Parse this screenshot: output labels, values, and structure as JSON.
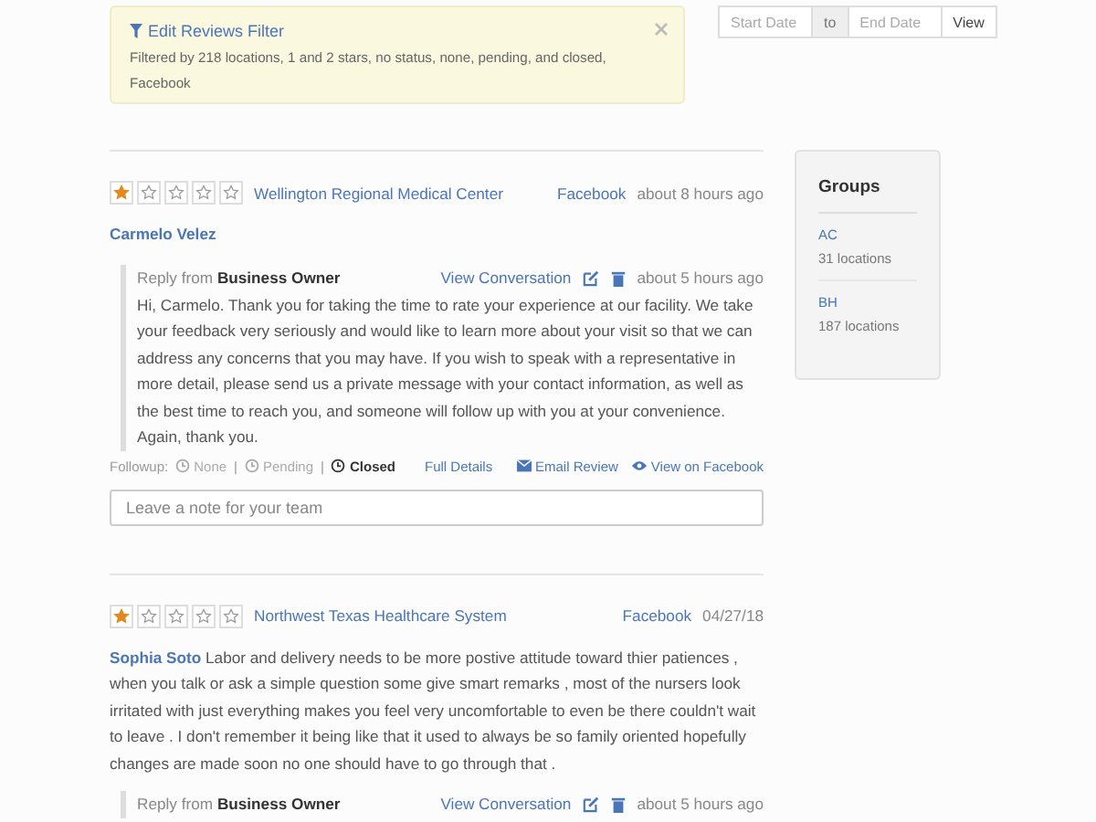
{
  "filter": {
    "title": "Edit Reviews Filter",
    "description": "Filtered by 218 locations, 1 and 2 stars, no status, none, pending, and closed, Facebook"
  },
  "date_range": {
    "start_placeholder": "Start Date",
    "separator": "to",
    "end_placeholder": "End Date",
    "button": "View"
  },
  "reviews": [
    {
      "stars": 1,
      "location": "Wellington Regional Medical Center",
      "source": "Facebook",
      "time": "about 8 hours ago",
      "author": "Carmelo Velez",
      "reply": {
        "prefix": "Reply from",
        "author": "Business Owner",
        "link": "View Conversation",
        "time": "about 5 hours ago",
        "text": "Hi, Carmelo. Thank you for taking the time to rate your experience at our facility. We take your feedback very seriously and would like to learn more about your visit so that we can address any concerns that you may have. If you wish to speak with a representative in more detail, please send us a private message with your contact information, as well as the best time to reach you, and someone will follow up with you at your convenience. Again, thank you."
      },
      "followup": {
        "label": "Followup:",
        "separator": "|",
        "options": [
          {
            "label": "None",
            "selected": false
          },
          {
            "label": "Pending",
            "selected": false
          },
          {
            "label": "Closed",
            "selected": true
          }
        ]
      },
      "details_link": "Full Details",
      "actions": [
        {
          "kind": "email",
          "label": "Email Review"
        },
        {
          "kind": "view",
          "label": "View on Facebook"
        }
      ],
      "note_placeholder": "Leave a note for your team"
    },
    {
      "stars": 1,
      "location": "Northwest Texas Healthcare System",
      "source": "Facebook",
      "time": "04/27/18",
      "author": "Sophia Soto",
      "text": "Labor and delivery needs to be more postive attitude toward thier patiences , when you talk or ask a simple question some give smart remarks , most of the nursers look irritated with just everything makes you feel very uncomfortable to even be there couldn't wait to leave . I don't remember it being like that it used to always be so family oriented hopefully changes are made soon no one should have to go through that .",
      "reply": {
        "prefix": "Reply from",
        "author": "Business Owner",
        "link": "View Conversation",
        "time": "about 5 hours ago"
      }
    }
  ],
  "groups": {
    "title": "Groups",
    "items": [
      {
        "name": "AC",
        "count": "31 locations"
      },
      {
        "name": "BH",
        "count": "187 locations"
      }
    ]
  }
}
